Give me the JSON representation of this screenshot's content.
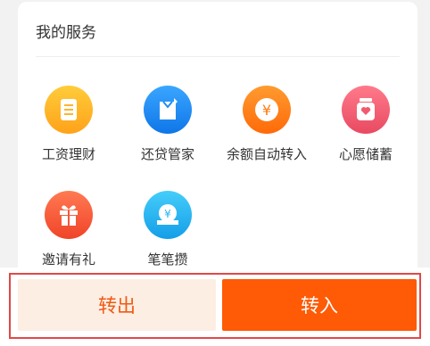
{
  "section": {
    "title": "我的服务"
  },
  "services": [
    {
      "label": "工资理财",
      "icon": "salary-icon",
      "color": "#ffb52a"
    },
    {
      "label": "还贷管家",
      "icon": "loan-icon",
      "color": "#1e8ef5"
    },
    {
      "label": "余额自动转入",
      "icon": "yuan-coin-icon",
      "color": "#ff7a12"
    },
    {
      "label": "心愿储蓄",
      "icon": "wish-jar-icon",
      "color": "#f25a70"
    },
    {
      "label": "邀请有礼",
      "icon": "gift-icon",
      "color": "#f7553a"
    },
    {
      "label": "笔笔攒",
      "icon": "piggy-save-icon",
      "color": "#25b6f0"
    }
  ],
  "actions": {
    "transfer_out": "转出",
    "transfer_in": "转入"
  },
  "colors": {
    "accent": "#ff5a05",
    "highlight_border": "#e04848"
  }
}
